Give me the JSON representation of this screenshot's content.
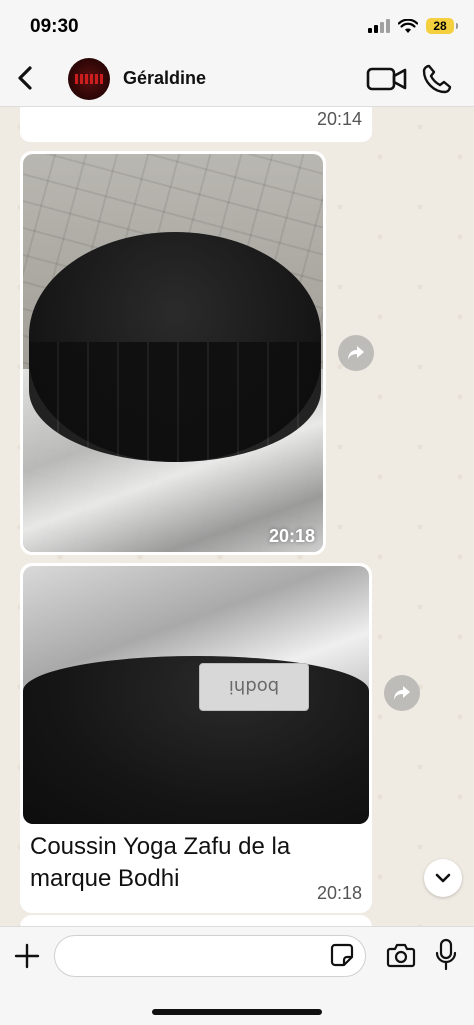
{
  "status_bar": {
    "time": "09:30",
    "battery_level": "28"
  },
  "header": {
    "contact_name": "Géraldine"
  },
  "messages": [
    {
      "type": "text-partial",
      "timestamp": "20:14"
    },
    {
      "type": "image",
      "timestamp": "20:18"
    },
    {
      "type": "image-with-caption",
      "label_text": "bodhi",
      "caption": "Coussin Yoga Zafu de la marque Bodhi",
      "timestamp": "20:18"
    }
  ],
  "input": {
    "value": "",
    "placeholder": ""
  },
  "colors": {
    "chat_background": "#efeae2",
    "bubble": "#ffffff",
    "bar_background": "#f6f6f6",
    "battery": "#f4d03f"
  },
  "icons": [
    "back-icon",
    "video-call-icon",
    "phone-icon",
    "forward-icon",
    "chevron-down-icon",
    "plus-icon",
    "sticker-icon",
    "camera-icon",
    "mic-icon"
  ]
}
